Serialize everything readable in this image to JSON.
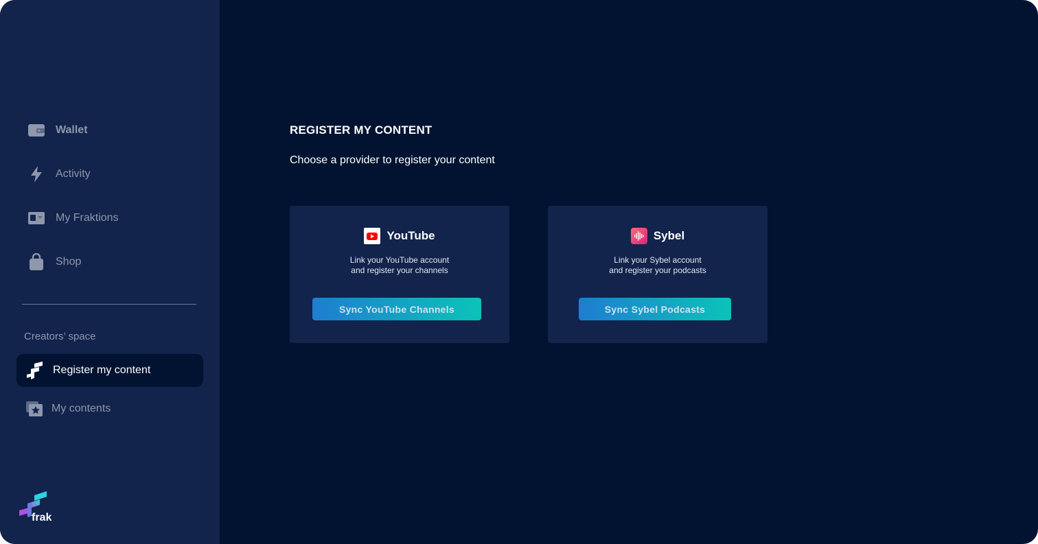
{
  "sidebar": {
    "items": [
      {
        "label": "Wallet",
        "icon": "wallet-icon"
      },
      {
        "label": "Activity",
        "icon": "bolt-icon"
      },
      {
        "label": "My Fraktions",
        "icon": "fraktions-icon"
      },
      {
        "label": "Shop",
        "icon": "shopping-bag-icon"
      }
    ],
    "section_title": "Creators’ space",
    "creator_items": [
      {
        "label": "Register my content",
        "icon": "frak-icon",
        "active": true
      },
      {
        "label": "My contents",
        "icon": "star-collection-icon"
      }
    ],
    "logo_text": "frak"
  },
  "main": {
    "title": "REGISTER MY CONTENT",
    "subtitle": "Choose a provider to register your content",
    "providers": [
      {
        "name": "YouTube",
        "icon": "youtube-icon",
        "desc_line1": "Link your YouTube account",
        "desc_line2": "and register your channels",
        "button": "Sync YouTube Channels"
      },
      {
        "name": "Sybel",
        "icon": "sybel-icon",
        "desc_line1": "Link your Sybel account",
        "desc_line2": "and register your podcasts",
        "button": "Sync Sybel Podcasts"
      }
    ]
  },
  "colors": {
    "sidebar_bg": "#12234c",
    "main_bg": "#011330",
    "accent_gradient_start": "#1e7dd0",
    "accent_gradient_end": "#0cc3b8",
    "youtube_red": "#ff0000"
  }
}
